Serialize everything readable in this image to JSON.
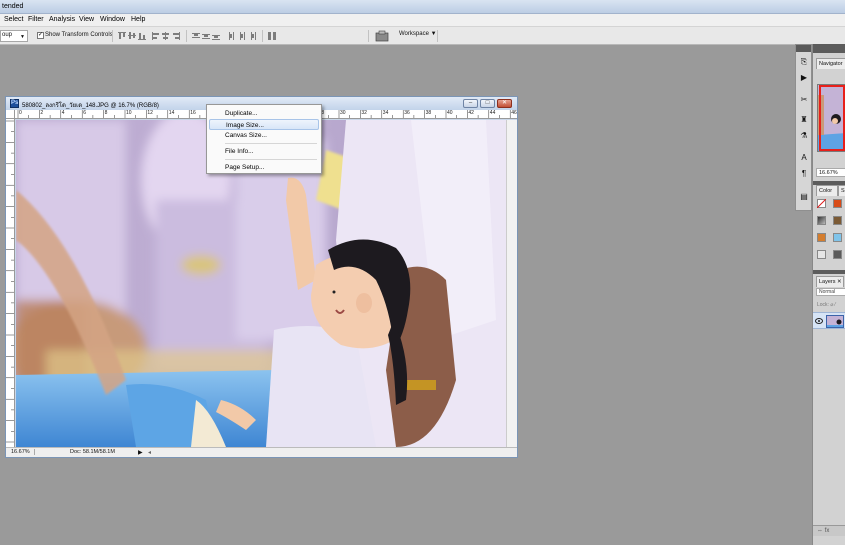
{
  "app": {
    "title": "tended"
  },
  "menubar": [
    {
      "id": "select",
      "label": "Select"
    },
    {
      "id": "filter",
      "label": "Filter"
    },
    {
      "id": "analysis",
      "label": "Analysis"
    },
    {
      "id": "view",
      "label": "View"
    },
    {
      "id": "window",
      "label": "Window"
    },
    {
      "id": "help",
      "label": "Help"
    }
  ],
  "options": {
    "tool_dropdown": "oup",
    "show_transform_controls": "Show Transform Controls",
    "show_transform_checked": "✓",
    "workspace": "Workspace ▼"
  },
  "document": {
    "title": "580802_ลงกรีโด_วัยเด_148.JPG @ 16.7% (RGB/8)",
    "icon_letter": "Ps",
    "ruler_numbers": [
      "0",
      "2",
      "4",
      "6",
      "8",
      "10",
      "12",
      "14",
      "16",
      "18",
      "20",
      "22",
      "24",
      "26",
      "28",
      "30",
      "32",
      "34",
      "36",
      "38",
      "40",
      "42",
      "44",
      "46"
    ],
    "zoom": "16.67%",
    "doc_size": "Doc: 58.1M/58.1M",
    "status_arrow": "▶",
    "scroll_left": "◂"
  },
  "context_menu": {
    "items": [
      {
        "label": "Duplicate...",
        "highlighted": false
      },
      {
        "label": "Image Size...",
        "highlighted": true
      },
      {
        "label": "Canvas Size...",
        "highlighted": false
      },
      {
        "label": "File Info...",
        "highlighted": false
      },
      {
        "label": "Page Setup...",
        "highlighted": false
      }
    ]
  },
  "panels": {
    "navigator_tab": "Navigator",
    "navigator_zoom": "16.67%",
    "color_tab": "Color",
    "swatches_tab": "S",
    "layers_tab": "Layers ✕",
    "layer_mode": "Normal",
    "lock_label": "Lock: ⌀ ⁄",
    "footer": "⇔  fx"
  },
  "colors": {
    "accent": "#3c63a8",
    "highlight": "#d8e6f8",
    "close_btn": "#c24f35"
  }
}
